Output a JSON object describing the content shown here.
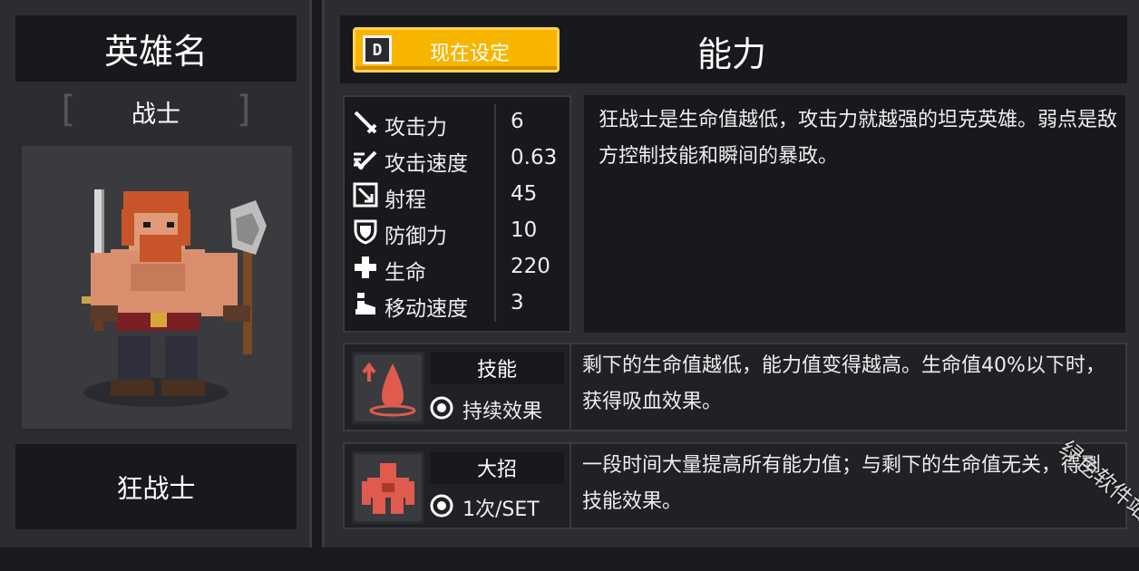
{
  "hero": {
    "name_header": "英雄名",
    "class_label": "战士",
    "hero_name": "狂战士"
  },
  "header": {
    "setting_button_label": "现在设定",
    "setting_button_key": "D",
    "title": "能力"
  },
  "stats": [
    {
      "icon": "sword-icon",
      "label": "攻击力",
      "value": "6"
    },
    {
      "icon": "speed-sword-icon",
      "label": "攻击速度",
      "value": "0.63"
    },
    {
      "icon": "range-icon",
      "label": "射程",
      "value": "45"
    },
    {
      "icon": "shield-icon",
      "label": "防御力",
      "value": "10"
    },
    {
      "icon": "health-cross-icon",
      "label": "生命",
      "value": "220"
    },
    {
      "icon": "boot-icon",
      "label": "移动速度",
      "value": "3"
    }
  ],
  "description": "狂战士是生命值越低，攻击力就越强的坦克英雄。弱点是敌方控制技能和瞬间的暴政。",
  "skill": {
    "title": "技能",
    "type_label": "持续效果",
    "description": "剩下的生命值越低，能力值变得越高。生命值40%以下时，获得吸血效果。"
  },
  "ultimate": {
    "title": "大招",
    "type_label": "1次/SET",
    "description": "一段时间大量提高所有能力值；与剩下的生命值无关，得到技能效果。"
  },
  "watermark": "绿色软件站",
  "colors": {
    "accent_yellow": "#f7b500",
    "skill_red": "#e05a4e",
    "panel_bg": "#2c2d31",
    "dark_bg": "#18191c"
  }
}
